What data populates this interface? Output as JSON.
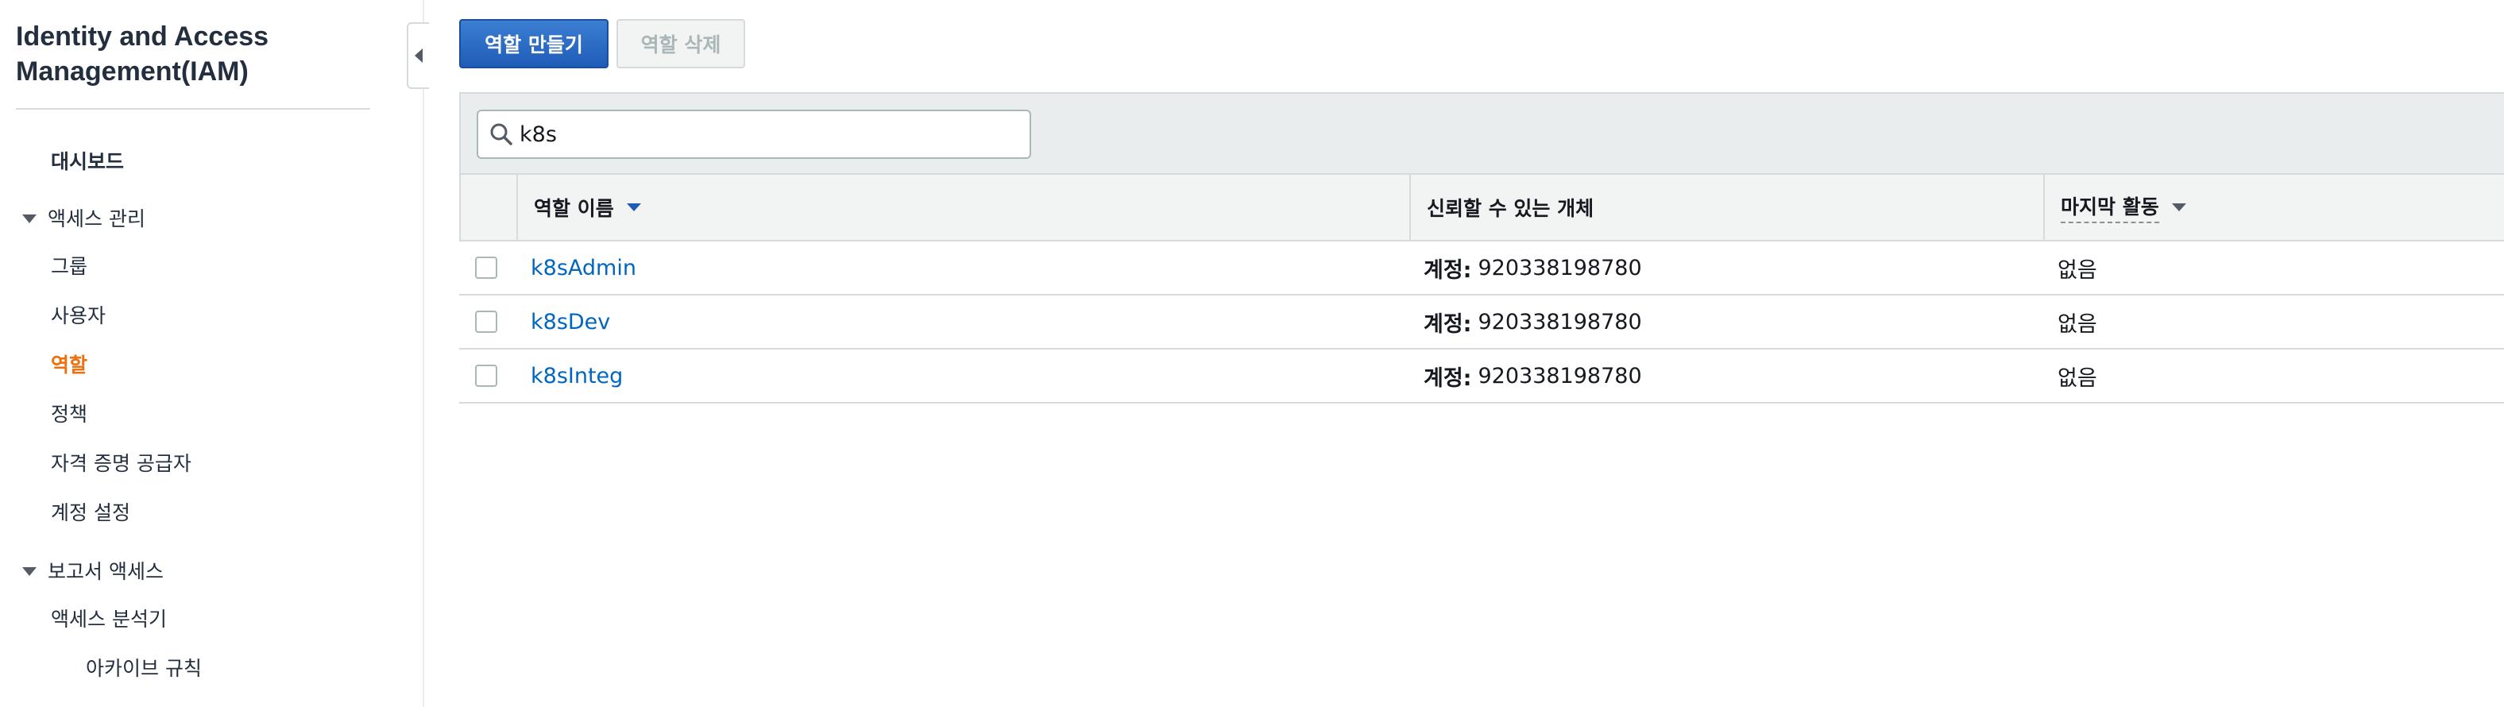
{
  "sidebar": {
    "title": "Identity and Access Management(IAM)",
    "items": [
      {
        "label": "대시보드"
      },
      {
        "label": "액세스 관리"
      },
      {
        "label": "그룹"
      },
      {
        "label": "사용자"
      },
      {
        "label": "역할"
      },
      {
        "label": "정책"
      },
      {
        "label": "자격 증명 공급자"
      },
      {
        "label": "계정 설정"
      },
      {
        "label": "보고서 액세스"
      },
      {
        "label": "액세스 분석기"
      },
      {
        "label": "아카이브 규칙"
      }
    ]
  },
  "toolbar": {
    "create_label": "역할 만들기",
    "delete_label": "역할 삭제"
  },
  "search": {
    "value": "k8s"
  },
  "table": {
    "columns": [
      "역할 이름",
      "신뢰할 수 있는 개체",
      "마지막 활동"
    ],
    "rows": [
      {
        "name": "k8sAdmin",
        "trust_label": "계정:",
        "trust_value": "920338198780",
        "last_activity": "없음"
      },
      {
        "name": "k8sDev",
        "trust_label": "계정:",
        "trust_value": "920338198780",
        "last_activity": "없음"
      },
      {
        "name": "k8sInteg",
        "trust_label": "계정:",
        "trust_value": "920338198780",
        "last_activity": "없음"
      }
    ]
  },
  "colors": {
    "primary": "#1f5cb8",
    "link": "#0066c0",
    "active_nav": "#ec7211"
  }
}
